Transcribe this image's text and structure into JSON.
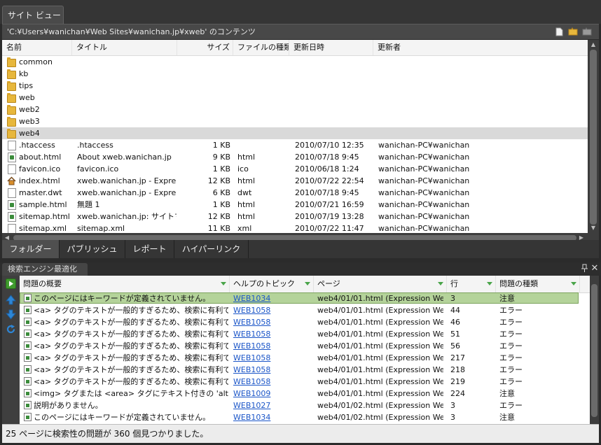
{
  "site_view": {
    "tab_label": "サイト ビュー",
    "path": "'C:¥Users¥wanichan¥Web Sites¥wanichan.jp¥xweb' のコンテンツ",
    "columns": [
      "名前",
      "タイトル",
      "サイズ",
      "ファイルの種類",
      "更新日時",
      "更新者"
    ],
    "rows": [
      {
        "icon": "folder-icon",
        "name": "common",
        "title": "",
        "size": "",
        "type": "",
        "modified": "",
        "author": ""
      },
      {
        "icon": "folder-icon",
        "name": "kb",
        "title": "",
        "size": "",
        "type": "",
        "modified": "",
        "author": ""
      },
      {
        "icon": "folder-icon",
        "name": "tips",
        "title": "",
        "size": "",
        "type": "",
        "modified": "",
        "author": ""
      },
      {
        "icon": "folder-icon",
        "name": "web",
        "title": "",
        "size": "",
        "type": "",
        "modified": "",
        "author": ""
      },
      {
        "icon": "folder-icon",
        "name": "web2",
        "title": "",
        "size": "",
        "type": "",
        "modified": "",
        "author": ""
      },
      {
        "icon": "folder-icon",
        "name": "web3",
        "title": "",
        "size": "",
        "type": "",
        "modified": "",
        "author": ""
      },
      {
        "icon": "folder-icon",
        "name": "web4",
        "title": "",
        "size": "",
        "type": "",
        "modified": "",
        "author": "",
        "selected": true
      },
      {
        "icon": "file-icon",
        "name": ".htaccess",
        "title": ".htaccess",
        "size": "1 KB",
        "type": "",
        "modified": "2010/07/10 12:35",
        "author": "wanichan-PC¥wanichan"
      },
      {
        "icon": "html-file-icon",
        "name": "about.html",
        "title": "About xweb.wanichan.jp",
        "size": "9 KB",
        "type": "html",
        "modified": "2010/07/18 9:45",
        "author": "wanichan-PC¥wanichan"
      },
      {
        "icon": "file-icon",
        "name": "favicon.ico",
        "title": "favicon.ico",
        "size": "1 KB",
        "type": "ico",
        "modified": "2010/06/18 1:24",
        "author": "wanichan-PC¥wanichan"
      },
      {
        "icon": "home-page-icon",
        "name": "index.html",
        "title": "xweb.wanichan.jp - Expre...",
        "size": "12 KB",
        "type": "html",
        "modified": "2010/07/22 22:54",
        "author": "wanichan-PC¥wanichan"
      },
      {
        "icon": "file-icon",
        "name": "master.dwt",
        "title": "xweb.wanichan.jp - Expre...",
        "size": "6 KB",
        "type": "dwt",
        "modified": "2010/07/18 9:45",
        "author": "wanichan-PC¥wanichan"
      },
      {
        "icon": "html-file-icon",
        "name": "sample.html",
        "title": "無題 1",
        "size": "1 KB",
        "type": "html",
        "modified": "2010/07/21 16:59",
        "author": "wanichan-PC¥wanichan"
      },
      {
        "icon": "html-file-icon",
        "name": "sitemap.html",
        "title": "xweb.wanichan.jp: サイトマ...",
        "size": "12 KB",
        "type": "html",
        "modified": "2010/07/19 13:28",
        "author": "wanichan-PC¥wanichan"
      },
      {
        "icon": "file-icon",
        "name": "sitemap.xml",
        "title": "sitemap.xml",
        "size": "11 KB",
        "type": "xml",
        "modified": "2010/07/22 11:47",
        "author": "wanichan-PC¥wanichan"
      }
    ],
    "bottom_tabs": [
      "フォルダー",
      "パブリッシュ",
      "レポート",
      "ハイパーリンク"
    ]
  },
  "seo": {
    "panel_title": "検索エンジン最適化",
    "columns": [
      "問題の概要",
      "ヘルプのトピック",
      "ページ",
      "行",
      "問題の種類"
    ],
    "rows": [
      {
        "summary": "このページにはキーワードが定義されていません。",
        "topic": "WEB1034",
        "page": "web4/01/01.html (Expression We...",
        "line": "3",
        "kind": "注意",
        "selected": true
      },
      {
        "summary": "<a> タグのテキストが一般的すぎるため、検索に有利では...",
        "topic": "WEB1058",
        "page": "web4/01/01.html (Expression We...",
        "line": "44",
        "kind": "エラー"
      },
      {
        "summary": "<a> タグのテキストが一般的すぎるため、検索に有利では...",
        "topic": "WEB1058",
        "page": "web4/01/01.html (Expression We...",
        "line": "46",
        "kind": "エラー"
      },
      {
        "summary": "<a> タグのテキストが一般的すぎるため、検索に有利では...",
        "topic": "WEB1058",
        "page": "web4/01/01.html (Expression We...",
        "line": "51",
        "kind": "エラー"
      },
      {
        "summary": "<a> タグのテキストが一般的すぎるため、検索に有利では...",
        "topic": "WEB1058",
        "page": "web4/01/01.html (Expression We...",
        "line": "56",
        "kind": "エラー"
      },
      {
        "summary": "<a> タグのテキストが一般的すぎるため、検索に有利では...",
        "topic": "WEB1058",
        "page": "web4/01/01.html (Expression We...",
        "line": "217",
        "kind": "エラー"
      },
      {
        "summary": "<a> タグのテキストが一般的すぎるため、検索に有利では...",
        "topic": "WEB1058",
        "page": "web4/01/01.html (Expression We...",
        "line": "218",
        "kind": "エラー"
      },
      {
        "summary": "<a> タグのテキストが一般的すぎるため、検索に有利では...",
        "topic": "WEB1058",
        "page": "web4/01/01.html (Expression We...",
        "line": "219",
        "kind": "エラー"
      },
      {
        "summary": "<img> タグまたは <area> タグにテキスト付きの 'alt' 属性...",
        "topic": "WEB1009",
        "page": "web4/01/01.html (Expression We...",
        "line": "224",
        "kind": "注意"
      },
      {
        "summary": "説明がありません。",
        "topic": "WEB1027",
        "page": "web4/01/02.html (Expression We...",
        "line": "3",
        "kind": "エラー"
      },
      {
        "summary": "このページにはキーワードが定義されていません。",
        "topic": "WEB1034",
        "page": "web4/01/02.html (Expression We...",
        "line": "3",
        "kind": "注意"
      }
    ],
    "status": "25 ページに検索性の問題が 360 個見つかりました。"
  },
  "colors": {
    "accent_selected_row": "#b4d39a",
    "link": "#1a55c8",
    "chrome_dark": "#353535"
  }
}
